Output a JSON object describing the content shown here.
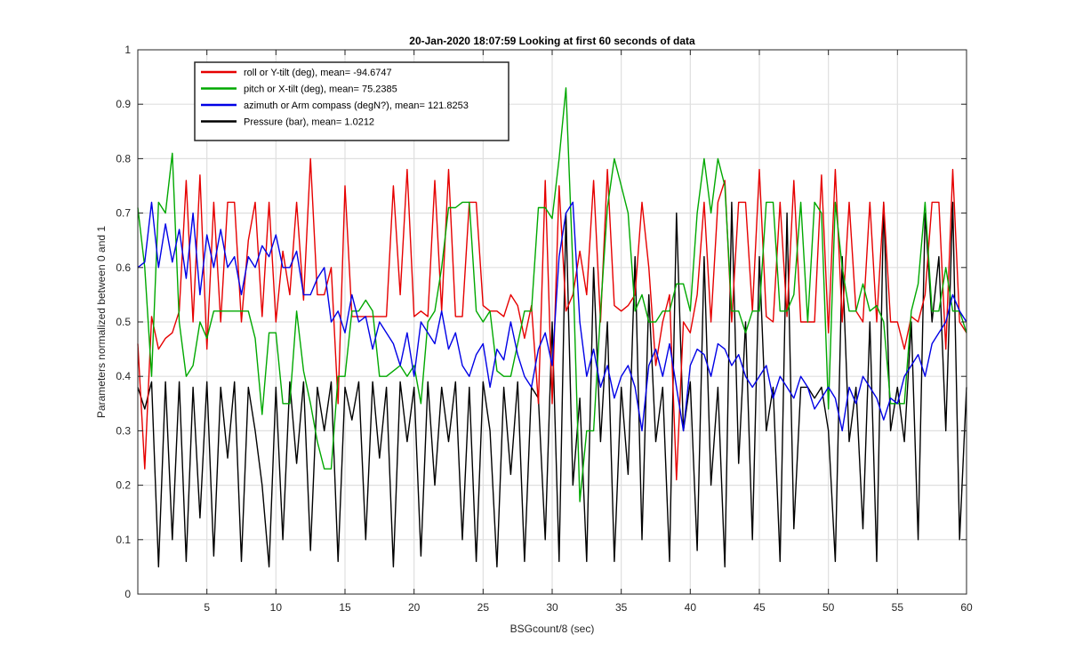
{
  "chart_data": {
    "type": "line",
    "title": "20-Jan-2020 18:07:59 Looking at first 60 seconds of data",
    "xlabel": "BSGcount/8 (sec)",
    "ylabel": "Parameters normalized between 0 and 1",
    "xlim": [
      0,
      60
    ],
    "ylim": [
      0,
      1
    ],
    "xticks": [
      5,
      10,
      15,
      20,
      25,
      30,
      35,
      40,
      45,
      50,
      55,
      60
    ],
    "xtick_labels": [
      "5",
      "10",
      "15",
      "20",
      "25",
      "30",
      "35",
      "40",
      "45",
      "50",
      "55",
      "60"
    ],
    "yticks": [
      0,
      0.1,
      0.2,
      0.3,
      0.4,
      0.5,
      0.6,
      0.7,
      0.8,
      0.9,
      1
    ],
    "ytick_labels": [
      "0",
      "0.1",
      "0.2",
      "0.3",
      "0.4",
      "0.5",
      "0.6",
      "0.7",
      "0.8",
      "0.9",
      "1"
    ],
    "grid": true,
    "legend_position": "top-left",
    "series": [
      {
        "name": "roll or Y-tilt (deg), mean= -94.6747",
        "color": "#e60000",
        "x": [
          0,
          0.5,
          1,
          1.5,
          2,
          2.5,
          3,
          3.5,
          4,
          4.5,
          5,
          5.5,
          6,
          6.5,
          7,
          7.5,
          8,
          8.5,
          9,
          9.5,
          10,
          10.5,
          11,
          11.5,
          12,
          12.5,
          13,
          13.5,
          14,
          14.5,
          15,
          15.5,
          16,
          16.5,
          17,
          17.5,
          18,
          18.5,
          19,
          19.5,
          20,
          20.5,
          21,
          21.5,
          22,
          22.5,
          23,
          23.5,
          24,
          24.5,
          25,
          25.5,
          26,
          26.5,
          27,
          27.5,
          28,
          28.5,
          29,
          29.5,
          30,
          30.5,
          31,
          31.5,
          32,
          32.5,
          33,
          33.5,
          34,
          34.5,
          35,
          35.5,
          36,
          36.5,
          37,
          37.5,
          38,
          38.5,
          39,
          39.5,
          40,
          40.5,
          41,
          41.5,
          42,
          42.5,
          43,
          43.5,
          44,
          44.5,
          45,
          45.5,
          46,
          46.5,
          47,
          47.5,
          48,
          48.5,
          49,
          49.5,
          50,
          50.5,
          51,
          51.5,
          52,
          52.5,
          53,
          53.5,
          54,
          54.5,
          55,
          55.5,
          56,
          56.5,
          57,
          57.5,
          58,
          58.5,
          59,
          59.5,
          60
        ],
        "y": [
          0.46,
          0.23,
          0.51,
          0.45,
          0.47,
          0.48,
          0.52,
          0.76,
          0.5,
          0.77,
          0.45,
          0.72,
          0.5,
          0.72,
          0.72,
          0.5,
          0.65,
          0.72,
          0.51,
          0.72,
          0.5,
          0.63,
          0.55,
          0.72,
          0.54,
          0.8,
          0.55,
          0.55,
          0.6,
          0.35,
          0.75,
          0.51,
          0.51,
          0.51,
          0.51,
          0.51,
          0.51,
          0.75,
          0.55,
          0.78,
          0.51,
          0.52,
          0.51,
          0.76,
          0.52,
          0.78,
          0.51,
          0.51,
          0.72,
          0.72,
          0.53,
          0.52,
          0.52,
          0.51,
          0.55,
          0.53,
          0.47,
          0.53,
          0.35,
          0.76,
          0.35,
          0.75,
          0.52,
          0.55,
          0.63,
          0.55,
          0.76,
          0.5,
          0.78,
          0.53,
          0.52,
          0.53,
          0.55,
          0.72,
          0.6,
          0.42,
          0.5,
          0.55,
          0.21,
          0.5,
          0.48,
          0.55,
          0.72,
          0.5,
          0.72,
          0.76,
          0.5,
          0.72,
          0.72,
          0.52,
          0.78,
          0.51,
          0.5,
          0.72,
          0.51,
          0.76,
          0.5,
          0.5,
          0.5,
          0.77,
          0.48,
          0.78,
          0.5,
          0.72,
          0.52,
          0.5,
          0.72,
          0.5,
          0.72,
          0.5,
          0.5,
          0.45,
          0.51,
          0.5,
          0.55,
          0.72,
          0.72,
          0.45,
          0.78,
          0.5,
          0.48
        ]
      },
      {
        "name": "pitch or X-tilt (deg), mean= 75.2385",
        "color": "#00a800",
        "x": [
          0,
          0.5,
          1,
          1.5,
          2,
          2.5,
          3,
          3.5,
          4,
          4.5,
          5,
          5.5,
          6,
          6.5,
          7,
          7.5,
          8,
          8.5,
          9,
          9.5,
          10,
          10.5,
          11,
          11.5,
          12,
          12.5,
          13,
          13.5,
          14,
          14.5,
          15,
          15.5,
          16,
          16.5,
          17,
          17.5,
          18,
          18.5,
          19,
          19.5,
          20,
          20.5,
          21,
          21.5,
          22,
          22.5,
          23,
          23.5,
          24,
          24.5,
          25,
          25.5,
          26,
          26.5,
          27,
          27.5,
          28,
          28.5,
          29,
          29.5,
          30,
          30.5,
          31,
          31.5,
          32,
          32.5,
          33,
          33.5,
          34,
          34.5,
          35,
          35.5,
          36,
          36.5,
          37,
          37.5,
          38,
          38.5,
          39,
          39.5,
          40,
          40.5,
          41,
          41.5,
          42,
          42.5,
          43,
          43.5,
          44,
          44.5,
          45,
          45.5,
          46,
          46.5,
          47,
          47.5,
          48,
          48.5,
          49,
          49.5,
          50,
          50.5,
          51,
          51.5,
          52,
          52.5,
          53,
          53.5,
          54,
          54.5,
          55,
          55.5,
          56,
          56.5,
          57,
          57.5,
          58,
          58.5,
          59,
          59.5,
          60
        ],
        "y": [
          0.71,
          0.6,
          0.4,
          0.72,
          0.7,
          0.81,
          0.5,
          0.4,
          0.42,
          0.5,
          0.47,
          0.52,
          0.52,
          0.52,
          0.52,
          0.52,
          0.52,
          0.47,
          0.33,
          0.48,
          0.48,
          0.35,
          0.35,
          0.52,
          0.41,
          0.35,
          0.28,
          0.23,
          0.23,
          0.4,
          0.4,
          0.52,
          0.52,
          0.54,
          0.52,
          0.4,
          0.4,
          0.41,
          0.42,
          0.4,
          0.42,
          0.35,
          0.5,
          0.52,
          0.6,
          0.71,
          0.71,
          0.72,
          0.72,
          0.52,
          0.5,
          0.52,
          0.41,
          0.4,
          0.4,
          0.46,
          0.52,
          0.52,
          0.71,
          0.71,
          0.69,
          0.8,
          0.93,
          0.6,
          0.17,
          0.3,
          0.3,
          0.52,
          0.71,
          0.8,
          0.75,
          0.7,
          0.52,
          0.55,
          0.5,
          0.5,
          0.52,
          0.52,
          0.57,
          0.57,
          0.52,
          0.7,
          0.8,
          0.7,
          0.8,
          0.75,
          0.52,
          0.52,
          0.48,
          0.52,
          0.52,
          0.72,
          0.72,
          0.52,
          0.52,
          0.55,
          0.72,
          0.5,
          0.72,
          0.7,
          0.34,
          0.72,
          0.6,
          0.52,
          0.52,
          0.57,
          0.52,
          0.53,
          0.5,
          0.35,
          0.35,
          0.35,
          0.52,
          0.57,
          0.72,
          0.52,
          0.52,
          0.6,
          0.52,
          0.52,
          0.48
        ]
      },
      {
        "name": "azimuth or Arm compass (degN?), mean= 121.8253",
        "color": "#0000e6",
        "x": [
          0,
          0.5,
          1,
          1.5,
          2,
          2.5,
          3,
          3.5,
          4,
          4.5,
          5,
          5.5,
          6,
          6.5,
          7,
          7.5,
          8,
          8.5,
          9,
          9.5,
          10,
          10.5,
          11,
          11.5,
          12,
          12.5,
          13,
          13.5,
          14,
          14.5,
          15,
          15.5,
          16,
          16.5,
          17,
          17.5,
          18,
          18.5,
          19,
          19.5,
          20,
          20.5,
          21,
          21.5,
          22,
          22.5,
          23,
          23.5,
          24,
          24.5,
          25,
          25.5,
          26,
          26.5,
          27,
          27.5,
          28,
          28.5,
          29,
          29.5,
          30,
          30.5,
          31,
          31.5,
          32,
          32.5,
          33,
          33.5,
          34,
          34.5,
          35,
          35.5,
          36,
          36.5,
          37,
          37.5,
          38,
          38.5,
          39,
          39.5,
          40,
          40.5,
          41,
          41.5,
          42,
          42.5,
          43,
          43.5,
          44,
          44.5,
          45,
          45.5,
          46,
          46.5,
          47,
          47.5,
          48,
          48.5,
          49,
          49.5,
          50,
          50.5,
          51,
          51.5,
          52,
          52.5,
          53,
          53.5,
          54,
          54.5,
          55,
          55.5,
          56,
          56.5,
          57,
          57.5,
          58,
          58.5,
          59,
          59.5,
          60
        ],
        "y": [
          0.6,
          0.61,
          0.72,
          0.6,
          0.68,
          0.61,
          0.67,
          0.58,
          0.7,
          0.55,
          0.66,
          0.6,
          0.67,
          0.6,
          0.62,
          0.55,
          0.62,
          0.6,
          0.64,
          0.62,
          0.66,
          0.6,
          0.6,
          0.63,
          0.55,
          0.55,
          0.58,
          0.6,
          0.5,
          0.52,
          0.48,
          0.55,
          0.5,
          0.51,
          0.45,
          0.5,
          0.48,
          0.46,
          0.42,
          0.48,
          0.4,
          0.5,
          0.48,
          0.46,
          0.52,
          0.45,
          0.48,
          0.42,
          0.4,
          0.44,
          0.46,
          0.38,
          0.45,
          0.43,
          0.5,
          0.44,
          0.4,
          0.38,
          0.45,
          0.48,
          0.42,
          0.62,
          0.7,
          0.72,
          0.5,
          0.4,
          0.45,
          0.38,
          0.42,
          0.36,
          0.4,
          0.42,
          0.38,
          0.3,
          0.42,
          0.45,
          0.4,
          0.46,
          0.38,
          0.3,
          0.42,
          0.45,
          0.44,
          0.4,
          0.46,
          0.45,
          0.42,
          0.44,
          0.4,
          0.38,
          0.4,
          0.42,
          0.36,
          0.4,
          0.38,
          0.36,
          0.4,
          0.38,
          0.34,
          0.36,
          0.38,
          0.36,
          0.3,
          0.38,
          0.35,
          0.4,
          0.38,
          0.36,
          0.32,
          0.36,
          0.35,
          0.4,
          0.42,
          0.44,
          0.4,
          0.46,
          0.48,
          0.5,
          0.55,
          0.52,
          0.5
        ]
      },
      {
        "name": "Pressure (bar), mean= 1.0212",
        "color": "#000000",
        "x": [
          0,
          0.5,
          1,
          1.5,
          2,
          2.5,
          3,
          3.5,
          4,
          4.5,
          5,
          5.5,
          6,
          6.5,
          7,
          7.5,
          8,
          8.5,
          9,
          9.5,
          10,
          10.5,
          11,
          11.5,
          12,
          12.5,
          13,
          13.5,
          14,
          14.5,
          15,
          15.5,
          16,
          16.5,
          17,
          17.5,
          18,
          18.5,
          19,
          19.5,
          20,
          20.5,
          21,
          21.5,
          22,
          22.5,
          23,
          23.5,
          24,
          24.5,
          25,
          25.5,
          26,
          26.5,
          27,
          27.5,
          28,
          28.5,
          29,
          29.5,
          30,
          30.5,
          31,
          31.5,
          32,
          32.5,
          33,
          33.5,
          34,
          34.5,
          35,
          35.5,
          36,
          36.5,
          37,
          37.5,
          38,
          38.5,
          39,
          39.5,
          40,
          40.5,
          41,
          41.5,
          42,
          42.5,
          43,
          43.5,
          44,
          44.5,
          45,
          45.5,
          46,
          46.5,
          47,
          47.5,
          48,
          48.5,
          49,
          49.5,
          50,
          50.5,
          51,
          51.5,
          52,
          52.5,
          53,
          53.5,
          54,
          54.5,
          55,
          55.5,
          56,
          56.5,
          57,
          57.5,
          58,
          58.5,
          59,
          59.5,
          60
        ],
        "y": [
          0.38,
          0.34,
          0.39,
          0.05,
          0.39,
          0.1,
          0.39,
          0.06,
          0.38,
          0.14,
          0.39,
          0.07,
          0.38,
          0.25,
          0.39,
          0.06,
          0.38,
          0.3,
          0.2,
          0.05,
          0.38,
          0.1,
          0.39,
          0.24,
          0.39,
          0.08,
          0.38,
          0.3,
          0.39,
          0.06,
          0.38,
          0.32,
          0.39,
          0.1,
          0.39,
          0.25,
          0.38,
          0.05,
          0.39,
          0.28,
          0.38,
          0.07,
          0.39,
          0.2,
          0.38,
          0.28,
          0.39,
          0.1,
          0.38,
          0.06,
          0.39,
          0.3,
          0.05,
          0.38,
          0.22,
          0.39,
          0.06,
          0.38,
          0.36,
          0.1,
          0.5,
          0.06,
          0.7,
          0.2,
          0.36,
          0.06,
          0.6,
          0.28,
          0.5,
          0.06,
          0.38,
          0.22,
          0.62,
          0.1,
          0.55,
          0.28,
          0.38,
          0.06,
          0.7,
          0.3,
          0.39,
          0.08,
          0.62,
          0.2,
          0.38,
          0.05,
          0.72,
          0.24,
          0.5,
          0.1,
          0.62,
          0.3,
          0.38,
          0.06,
          0.7,
          0.12,
          0.38,
          0.38,
          0.36,
          0.38,
          0.3,
          0.06,
          0.62,
          0.28,
          0.38,
          0.12,
          0.5,
          0.06,
          0.72,
          0.3,
          0.38,
          0.28,
          0.5,
          0.1,
          0.7,
          0.5,
          0.62,
          0.3,
          0.72,
          0.1,
          0.38
        ]
      }
    ]
  }
}
